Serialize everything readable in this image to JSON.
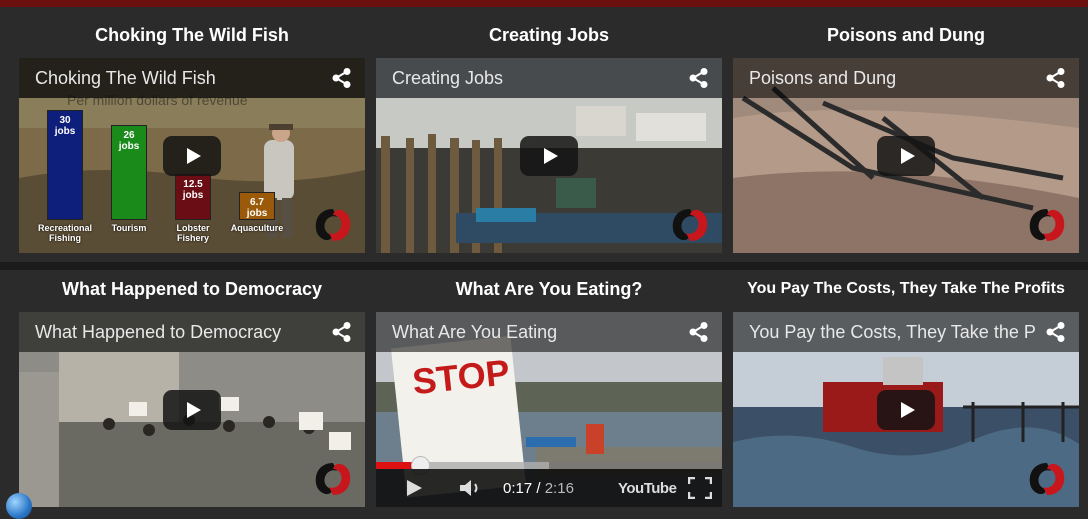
{
  "videos": [
    {
      "heading": "Choking The Wild Fish",
      "overlay_title": "Choking The Wild Fish"
    },
    {
      "heading": "Creating Jobs",
      "overlay_title": "Creating Jobs"
    },
    {
      "heading": "Poisons and Dung",
      "overlay_title": "Poisons and Dung"
    },
    {
      "heading": "What Happened to Democracy",
      "overlay_title": "What Happened to Democracy"
    },
    {
      "heading": "What Are You Eating?",
      "overlay_title": "What Are You Eating",
      "player": {
        "current_time": "0:17",
        "duration": "2:16",
        "progress_fraction": 0.127,
        "buffered_fraction": 0.5,
        "brand": "YouTube"
      }
    },
    {
      "heading": "You Pay The Costs, They Take The Profits",
      "overlay_title": "You Pay the Costs, They Take the Profits"
    }
  ],
  "chart_overlay": {
    "title": "Per million dollars of revenue",
    "bars": [
      {
        "value_label": "30\njobs",
        "category": "Recreational\nFishing",
        "value": 30,
        "color": "#0d1f7a"
      },
      {
        "value_label": "26\njobs",
        "category": "Tourism",
        "value": 26,
        "color": "#1a8a1a"
      },
      {
        "value_label": "12.5\njobs",
        "category": "Lobster\nFishery",
        "value": 12.5,
        "color": "#6a0d14"
      },
      {
        "value_label": "6.7\njobs",
        "category": "Aquaculture",
        "value": 6.7,
        "color": "#9a5a0a"
      }
    ]
  },
  "colors": {
    "accent_red": "#d11111",
    "top_bar": "#6b0f0f",
    "background": "#2b2b2b"
  },
  "icons": {
    "share": "share-icon",
    "play": "play-icon",
    "logo": "fish-logo-icon",
    "fullscreen": "fullscreen-icon",
    "volume": "volume-icon",
    "globe": "globe-icon"
  }
}
